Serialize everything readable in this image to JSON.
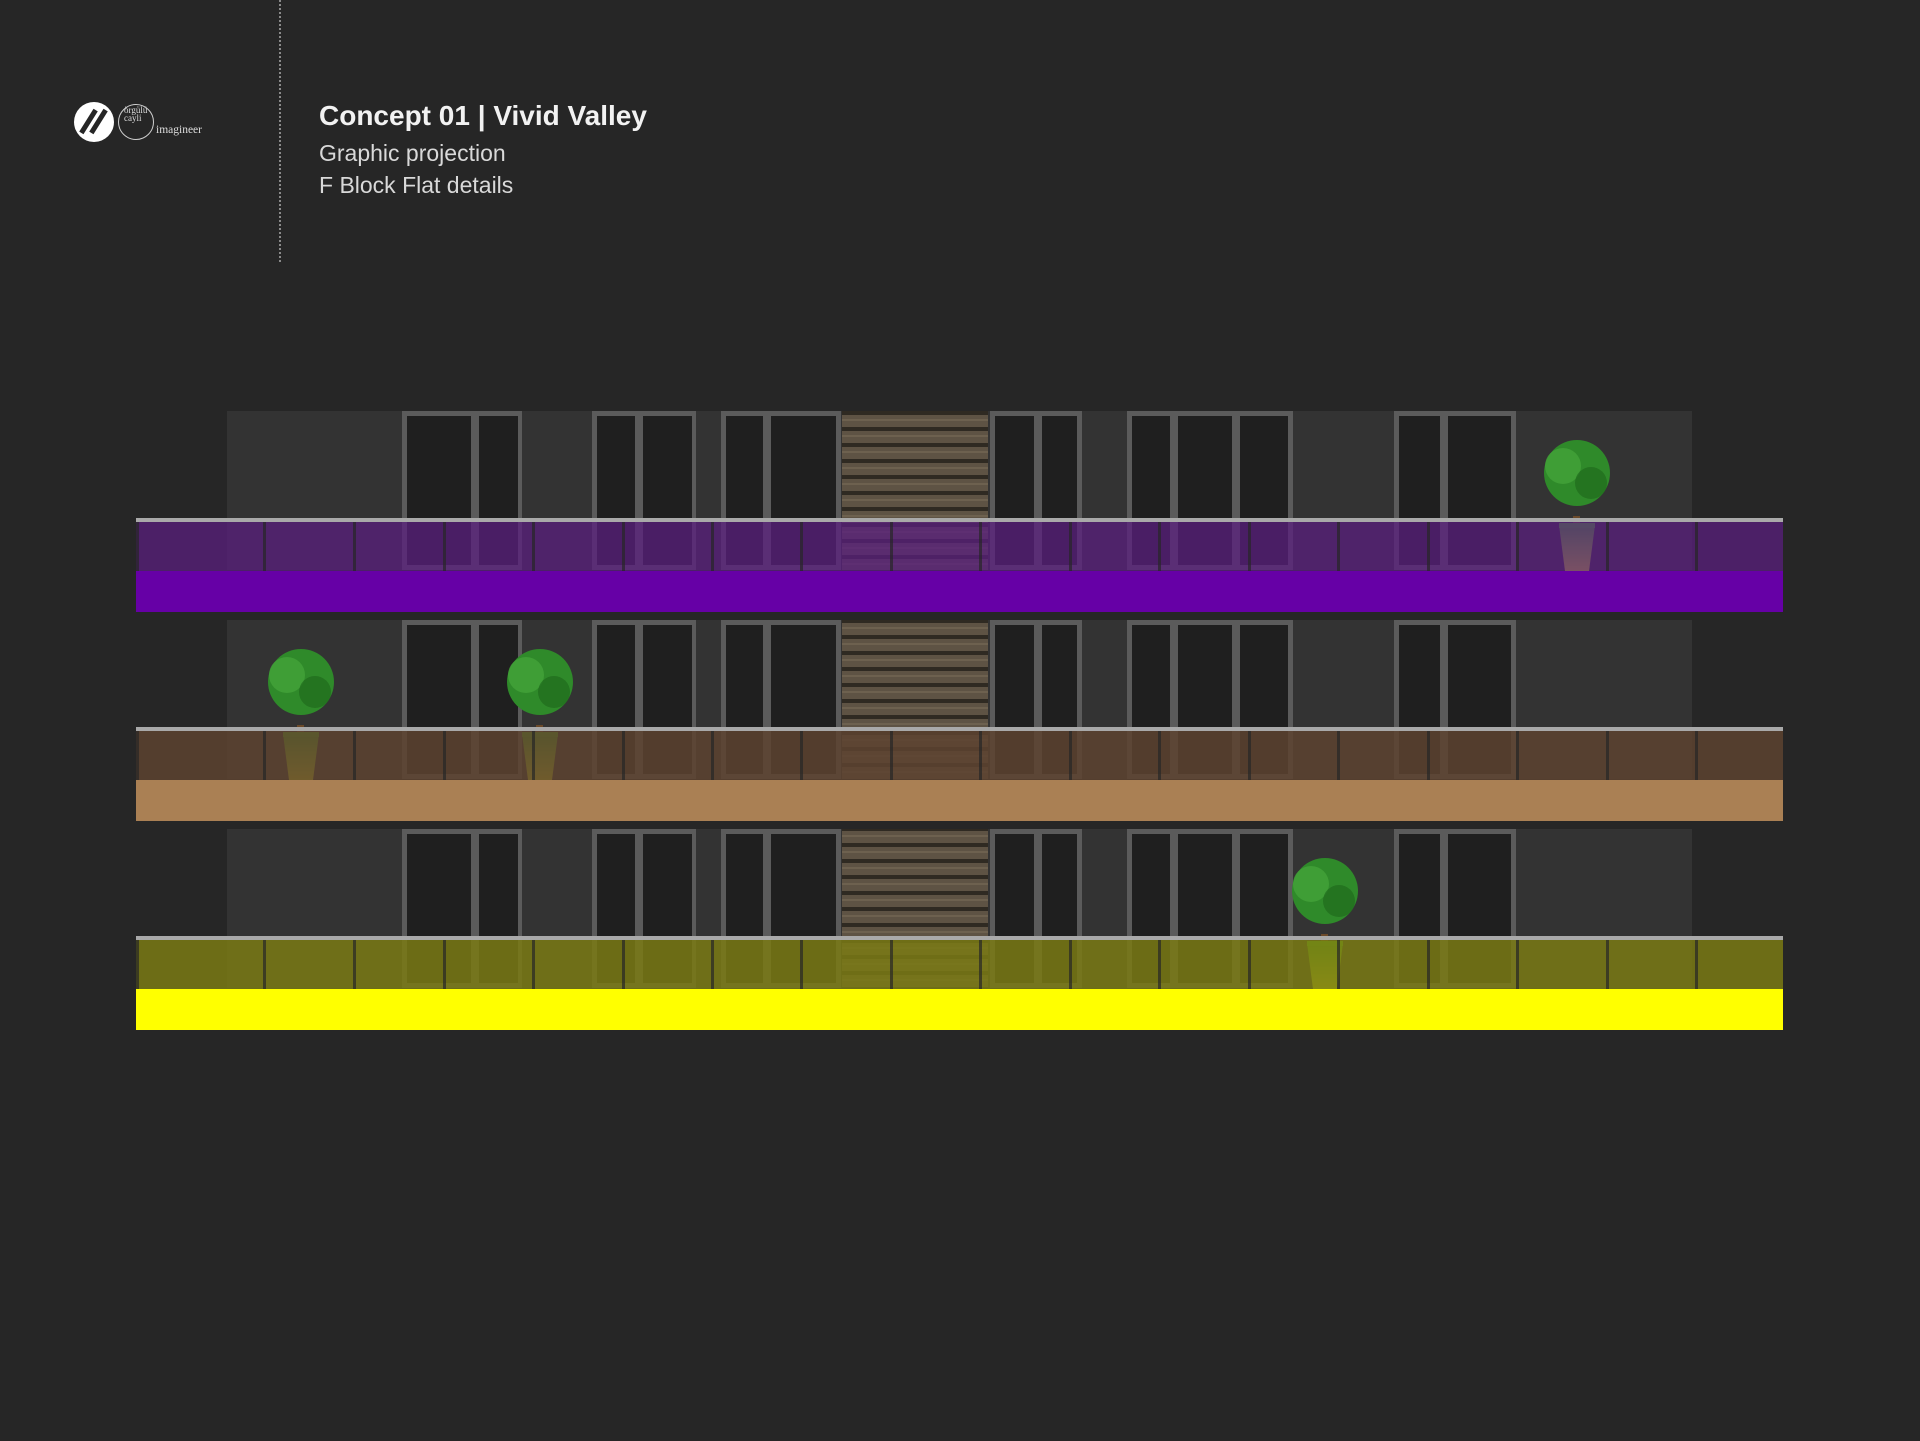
{
  "header": {
    "title": "Concept 01 | Vivid Valley",
    "subtitle_1": "Graphic projection",
    "subtitle_2": "F Block Flat details"
  },
  "logo": {
    "mark_icon": "slash-circle-logo-icon",
    "small_text": "örgülü cayli",
    "word": "imagineer"
  },
  "elevation": {
    "floors": [
      {
        "label": "top-floor",
        "slab_color": "#6600a6",
        "rail_color": "#5a1f7d",
        "rail_opacity": 0.75
      },
      {
        "label": "middle-floor",
        "slab_color": "#aa8054",
        "rail_color": "#5d4330",
        "rail_opacity": 0.85
      },
      {
        "label": "bottom-floor",
        "slab_color": "#ffff00",
        "rail_color": "#7a7a14",
        "rail_opacity": 0.85
      }
    ],
    "wall_color": "#333333",
    "frame_color": "#5b5b5b",
    "glass_color": "#1f1f1f",
    "wood_color": "#5e5344",
    "handrail_color": "#a9a9a9",
    "plant_leaf_color": "#2f8a2a",
    "pot_color": "#9ad51a"
  }
}
